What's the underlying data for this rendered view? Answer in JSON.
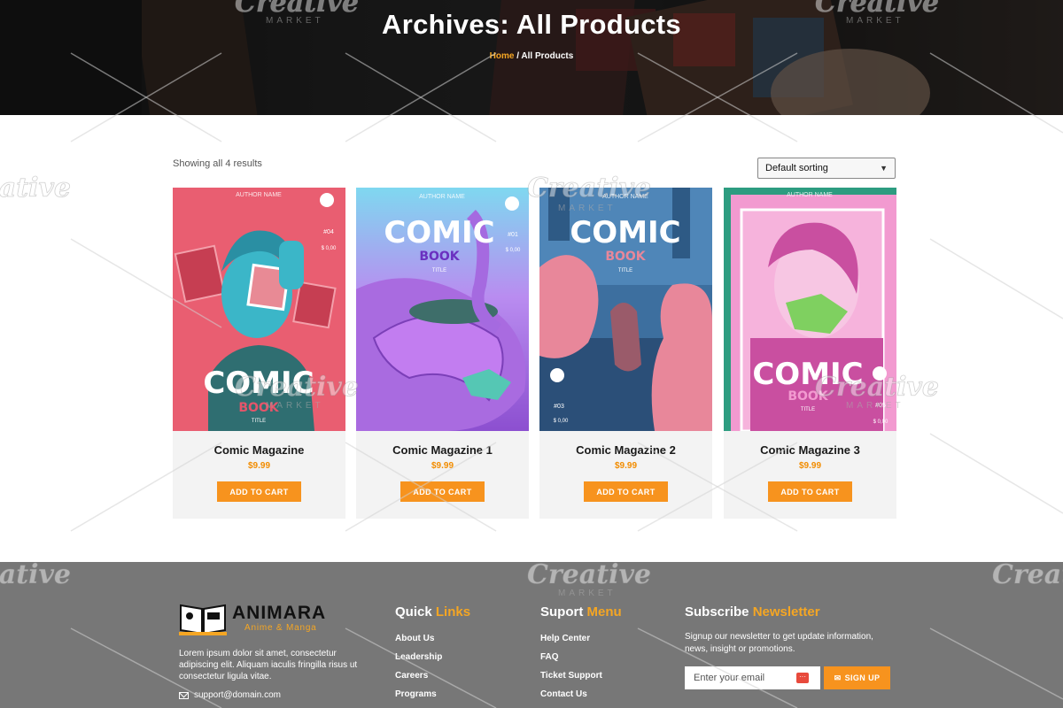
{
  "hero": {
    "title": "Archives: All Products",
    "breadcrumb_home": "Home",
    "breadcrumb_sep": " / ",
    "breadcrumb_current": "All Products"
  },
  "shop": {
    "result_count": "Showing all 4 results",
    "sort_selected": "Default sorting"
  },
  "products": [
    {
      "title": "Comic Magazine",
      "price": "$9.99",
      "button": "ADD TO CART",
      "cover": {
        "author": "AUTHOR NAME",
        "word1": "COMIC",
        "word2": "BOOK",
        "word3": "TITLE",
        "issue": "#04",
        "price": "$ 0,00",
        "colors": [
          "#3bb6c8",
          "#e5556a"
        ]
      }
    },
    {
      "title": "Comic Magazine 1",
      "price": "$9.99",
      "button": "ADD TO CART",
      "cover": {
        "author": "AUTHOR NAME",
        "word1": "COMIC",
        "word2": "BOOK",
        "word3": "TITLE",
        "issue": "#01",
        "price": "$ 0,00",
        "colors": [
          "#b56be8",
          "#7fd8f0"
        ]
      }
    },
    {
      "title": "Comic Magazine 2",
      "price": "$9.99",
      "button": "ADD TO CART",
      "cover": {
        "author": "AUTHOR NAME",
        "word1": "COMIC",
        "word2": "BOOK",
        "word3": "TITLE",
        "issue": "#03",
        "price": "$ 0,00",
        "colors": [
          "#3d6f9f",
          "#e8879a"
        ]
      }
    },
    {
      "title": "Comic Magazine 3",
      "price": "$9.99",
      "button": "ADD TO CART",
      "cover": {
        "author": "AUTHOR NAME",
        "word1": "COMIC",
        "word2": "BOOK",
        "word3": "TITLE",
        "issue": "#05",
        "price": "$ 0,00",
        "colors": [
          "#f29ad0",
          "#c94fa0"
        ]
      }
    }
  ],
  "footer": {
    "brand_name": "ANIMARA",
    "brand_tag": "Anime & Manga",
    "about": "Lorem ipsum dolor sit amet, consectetur adipiscing elit. Aliquam iaculis fringilla risus ut consectetur ligula vitae.",
    "email": "support@domain.com",
    "quick": {
      "title_a": "Quick",
      "title_b": "Links",
      "items": [
        "About Us",
        "Leadership",
        "Careers",
        "Programs"
      ]
    },
    "support": {
      "title_a": "Suport",
      "title_b": "Menu",
      "items": [
        "Help Center",
        "FAQ",
        "Ticket Support",
        "Contact Us"
      ]
    },
    "newsletter": {
      "title_a": "Subscribe",
      "title_b": "Newsletter",
      "text": "Signup our newsletter to get update information, news, insight or promotions.",
      "placeholder": "Enter your email",
      "button": "SIGN UP"
    }
  },
  "watermark": {
    "title": "Creative",
    "sub": "MARKET"
  },
  "colors": {
    "accent": "#f7931e",
    "footer_bg": "#777777",
    "card_bg": "#f3f3f3"
  }
}
